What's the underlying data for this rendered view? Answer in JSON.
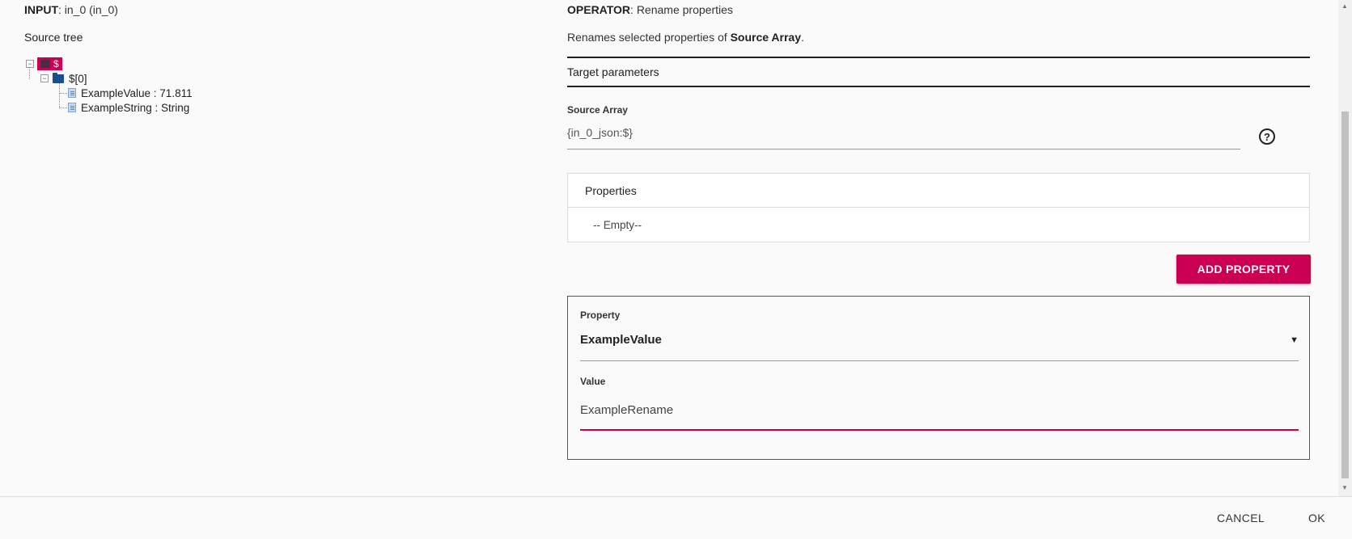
{
  "input": {
    "prefix": "INPUT",
    "value": ": in_0 (in_0)"
  },
  "source_tree": {
    "label": "Source tree",
    "root": {
      "label": "$"
    },
    "node": {
      "label": "$[0]"
    },
    "leaves": [
      {
        "label": "ExampleValue : 71.811"
      },
      {
        "label": "ExampleString : String"
      }
    ]
  },
  "operator": {
    "prefix": "OPERATOR",
    "value": ": Rename properties"
  },
  "description": {
    "text": "Renames selected properties of ",
    "emphasis": "Source Array",
    "suffix": "."
  },
  "target_parameters": {
    "label": "Target parameters"
  },
  "source_array": {
    "label": "Source Array",
    "value": "{in_0_json:$}"
  },
  "properties": {
    "header": "Properties",
    "empty_text": "-- Empty--"
  },
  "add_property_button": {
    "label": "ADD PROPERTY"
  },
  "property_card": {
    "property_label": "Property",
    "property_value": "ExampleValue",
    "value_label": "Value",
    "value_value": "ExampleRename"
  },
  "footer": {
    "cancel": "CANCEL",
    "ok": "OK"
  },
  "colors": {
    "accent": "#cc0052",
    "folder": "#1a4e8c"
  },
  "icons": {
    "help": "help-circle-icon",
    "select_arrow": "dropdown-triangle-icon",
    "folder": "folder-icon",
    "file": "file-icon"
  }
}
